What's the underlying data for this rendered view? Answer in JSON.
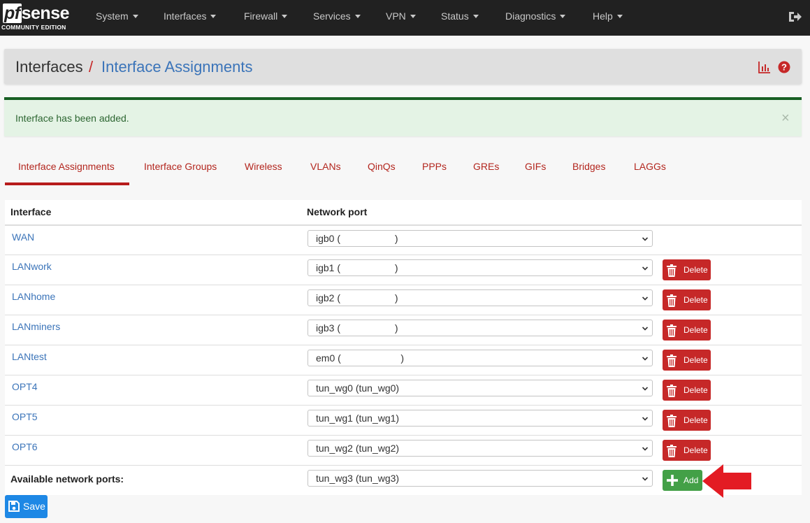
{
  "brand": {
    "name_pf": "pf",
    "name_rest": "sense",
    "edition": "COMMUNITY EDITION"
  },
  "nav": {
    "items": [
      {
        "label": "System"
      },
      {
        "label": "Interfaces"
      },
      {
        "label": "Firewall"
      },
      {
        "label": "Services"
      },
      {
        "label": "VPN"
      },
      {
        "label": "Status"
      },
      {
        "label": "Diagnostics"
      },
      {
        "label": "Help"
      }
    ],
    "logout_icon": "sign-out-icon"
  },
  "breadcrumb": {
    "root": "Interfaces",
    "separator": "/",
    "current": "Interface Assignments"
  },
  "header_icons": [
    "bar-chart-icon",
    "question-circle-icon"
  ],
  "alert": {
    "message": "Interface has been added.",
    "close": "×"
  },
  "tabs": [
    {
      "label": "Interface Assignments",
      "active": true
    },
    {
      "label": "Interface Groups"
    },
    {
      "label": "Wireless"
    },
    {
      "label": "VLANs"
    },
    {
      "label": "QinQs"
    },
    {
      "label": "PPPs"
    },
    {
      "label": "GREs"
    },
    {
      "label": "GIFs"
    },
    {
      "label": "Bridges"
    },
    {
      "label": "LAGGs"
    }
  ],
  "table": {
    "headers": {
      "interface": "Interface",
      "network_port": "Network port"
    },
    "rows": [
      {
        "interface": "WAN",
        "port": "igb0 (                    )",
        "deletable": false
      },
      {
        "interface": "LANwork",
        "port": "igb1 (                    )",
        "deletable": true
      },
      {
        "interface": "LANhome",
        "port": "igb2 (                    )",
        "deletable": true
      },
      {
        "interface": "LANminers",
        "port": "igb3 (                    )",
        "deletable": true
      },
      {
        "interface": "LANtest",
        "port": "em0 (                      )",
        "deletable": true
      },
      {
        "interface": "OPT4",
        "port": "tun_wg0 (tun_wg0)",
        "deletable": true
      },
      {
        "interface": "OPT5",
        "port": "tun_wg1 (tun_wg1)",
        "deletable": true
      },
      {
        "interface": "OPT6",
        "port": "tun_wg2 (tun_wg2)",
        "deletable": true
      }
    ],
    "delete_label": "Delete",
    "available": {
      "label": "Available network ports:",
      "port": "tun_wg3 (tun_wg3)",
      "add_label": "Add"
    }
  },
  "save_label": "Save",
  "colors": {
    "navbar": "#212121",
    "link_blue": "#3b74b9",
    "tab_red": "#b3261e",
    "delete_red": "#c62828",
    "add_green": "#43a047",
    "save_blue": "#1e88e5",
    "alert_bg": "#e4f3e5",
    "annotation_arrow": "#e31b23"
  }
}
